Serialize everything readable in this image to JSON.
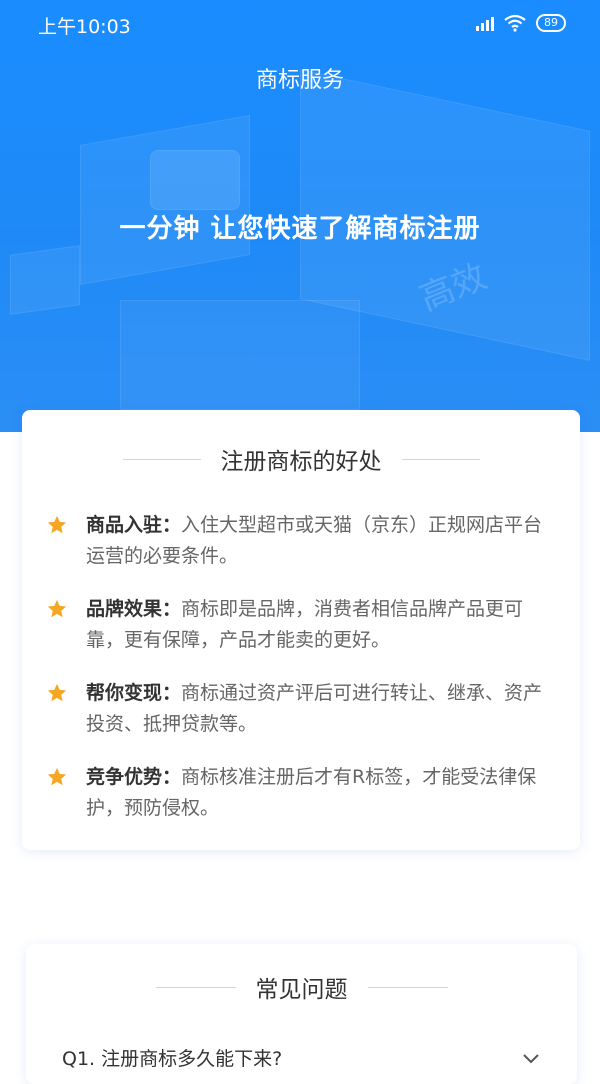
{
  "status_bar": {
    "time": "上午10:03",
    "battery": "89"
  },
  "header": {
    "title": "商标服务",
    "headline": "一分钟 让您快速了解商标注册",
    "decorative_text": "高效"
  },
  "benefits": {
    "title": "注册商标的好处",
    "items": [
      {
        "label": "商品入驻：",
        "text": "入住大型超市或天猫（京东）正规网店平台运营的必要条件。"
      },
      {
        "label": "品牌效果：",
        "text": "商标即是品牌，消费者相信品牌产品更可靠，更有保障，产品才能卖的更好。"
      },
      {
        "label": "帮你变现：",
        "text": "商标通过资产评后可进行转让、继承、资产投资、抵押贷款等。"
      },
      {
        "label": "竞争优势：",
        "text": "商标核准注册后才有R标签，才能受法律保护，预防侵权。"
      }
    ]
  },
  "faq": {
    "title": "常见问题",
    "items": [
      {
        "question": "Q1. 注册商标多久能下来?"
      }
    ]
  },
  "colors": {
    "primary": "#1a8cff",
    "star": "#f5a623",
    "text_dark": "#333333",
    "text_muted": "#666666"
  }
}
